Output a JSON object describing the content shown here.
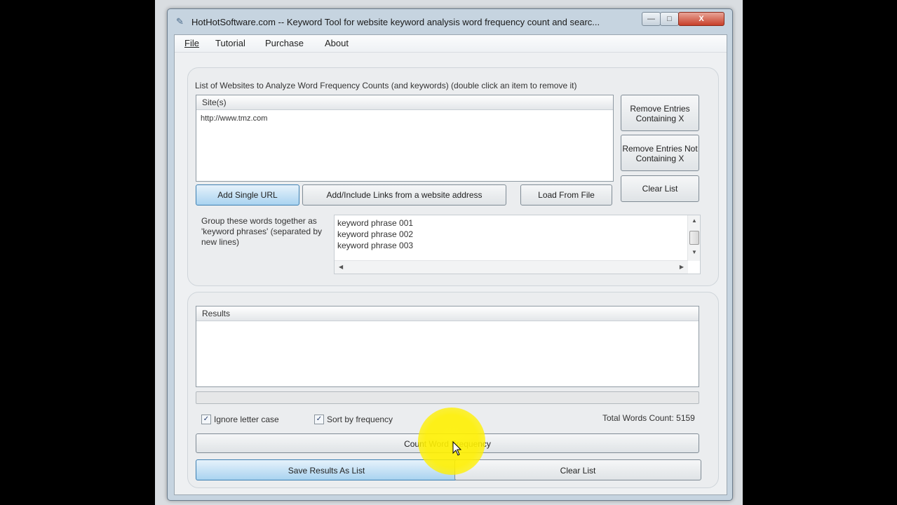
{
  "window": {
    "title": "HotHotSoftware.com -- Keyword Tool for website keyword analysis word frequency count and searc...",
    "minimize_glyph": "—",
    "maximize_glyph": "□",
    "close_glyph": "X",
    "app_icon": "feather-icon"
  },
  "menu": [
    "File",
    "Tutorial",
    "Purchase",
    "About"
  ],
  "sites": {
    "caption": "List of Websites to Analyze Word Frequency Counts (and keywords) (double click an item to remove it)",
    "column_header": "Site(s)",
    "items": [
      "http://www.tmz.com"
    ],
    "remove_containing_label": "Remove Entries Containing X",
    "remove_not_containing_label": "Remove Entries Not Containing X",
    "clear_label": "Clear List",
    "add_single_label": "Add Single URL",
    "add_links_label": "Add/Include Links from a website address",
    "load_file_label": "Load From File"
  },
  "phrases": {
    "caption": "Group these words together as 'keyword phrases' (separated by new lines)",
    "lines": [
      "keyword phrase 001",
      "keyword phrase 002",
      "keyword phrase 003"
    ]
  },
  "results": {
    "column_header": "Results",
    "progress": 0,
    "ignore_case_label": "Ignore letter case",
    "ignore_case_checked": true,
    "sort_label": "Sort by frequency",
    "sort_checked": true,
    "total_words": "Total Words Count: 5159",
    "count_label": "Count Word Frequency",
    "save_label": "Save Results As List",
    "clear_label": "Clear List"
  }
}
